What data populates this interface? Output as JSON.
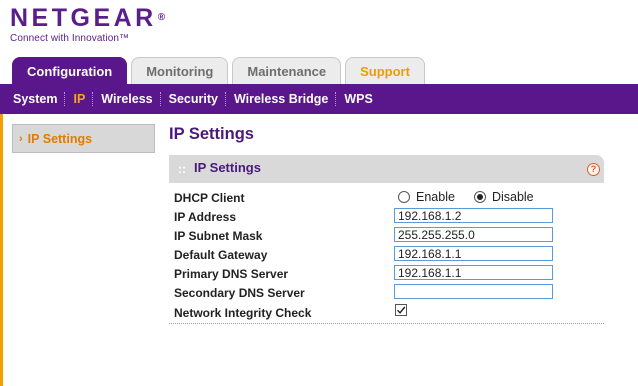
{
  "brand": {
    "name": "NETGEAR",
    "reg": "®",
    "tagline": "Connect with Innovation™"
  },
  "tabs": [
    {
      "label": "Configuration",
      "active": true
    },
    {
      "label": "Monitoring",
      "active": false
    },
    {
      "label": "Maintenance",
      "active": false
    },
    {
      "label": "Support",
      "active": false
    }
  ],
  "subnav": [
    {
      "label": "System",
      "active": false
    },
    {
      "label": "IP",
      "active": true
    },
    {
      "label": "Wireless",
      "active": false
    },
    {
      "label": "Security",
      "active": false
    },
    {
      "label": "Wireless Bridge",
      "active": false
    },
    {
      "label": "WPS",
      "active": false
    }
  ],
  "sidenav": {
    "arrow": "›",
    "label": "IP Settings"
  },
  "page_title": "IP Settings",
  "section": {
    "grip": "::",
    "title": "IP Settings",
    "help": "?"
  },
  "form": {
    "dhcp": {
      "label": "DHCP Client",
      "options": [
        "Enable",
        "Disable"
      ],
      "selected": "Disable"
    },
    "ip_address": {
      "label": "IP Address",
      "value": "192.168.1.2"
    },
    "subnet_mask": {
      "label": "IP Subnet Mask",
      "value": "255.255.255.0"
    },
    "gateway": {
      "label": "Default Gateway",
      "value": "192.168.1.1"
    },
    "primary_dns": {
      "label": "Primary DNS Server",
      "value": "192.168.1.1"
    },
    "secondary_dns": {
      "label": "Secondary DNS Server",
      "value": ""
    },
    "integrity": {
      "label": "Network Integrity Check",
      "checked": true
    }
  },
  "colors": {
    "brand_purple": "#5a168b",
    "accent_orange": "#f5a623",
    "support_gold": "#e8a000"
  }
}
